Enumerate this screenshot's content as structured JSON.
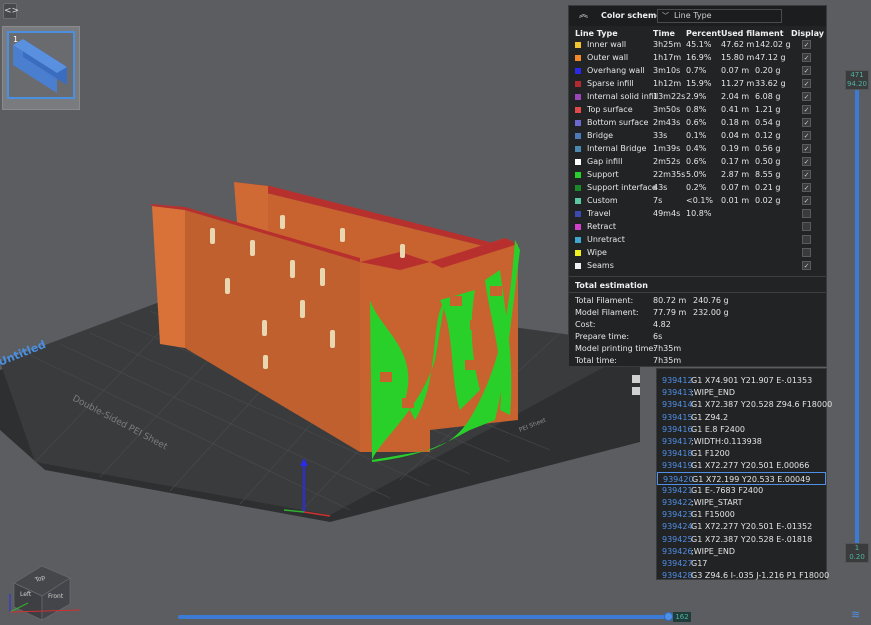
{
  "plate": {
    "number": "1"
  },
  "toolbar": {
    "collapse_glyph": "<>"
  },
  "scene": {
    "plate_brand": "Untitled",
    "sheet_label": "Double-Sided PEI Sheet",
    "sheet_label_2": "PEI Sheet"
  },
  "legend": {
    "collapse_glyph": "︽",
    "scheme_label": "Color scheme",
    "scheme_value": "Line Type",
    "headers": {
      "type": "Line Type",
      "time": "Time",
      "percent": "Percent",
      "used": "Used filament",
      "display": "Display"
    },
    "rows": [
      {
        "name": "Inner wall",
        "color": "#f2c230",
        "time": "3h25m",
        "percent": "45.1%",
        "m": "47.62 m",
        "g": "142.02 g",
        "display": true
      },
      {
        "name": "Outer wall",
        "color": "#f28a2c",
        "time": "1h17m",
        "percent": "16.9%",
        "m": "15.80 m",
        "g": "47.12 g",
        "display": true
      },
      {
        "name": "Overhang wall",
        "color": "#2a2ae8",
        "time": "3m10s",
        "percent": "0.7%",
        "m": "0.07 m",
        "g": "0.20 g",
        "display": true
      },
      {
        "name": "Sparse infill",
        "color": "#b02a30",
        "time": "1h12m",
        "percent": "15.9%",
        "m": "11.27 m",
        "g": "33.62 g",
        "display": true
      },
      {
        "name": "Internal solid infill",
        "color": "#9a46b8",
        "time": "13m22s",
        "percent": "2.9%",
        "m": "2.04 m",
        "g": "6.08 g",
        "display": true
      },
      {
        "name": "Top surface",
        "color": "#e04a4a",
        "time": "3m50s",
        "percent": "0.8%",
        "m": "0.41 m",
        "g": "1.21 g",
        "display": true
      },
      {
        "name": "Bottom surface",
        "color": "#6a6ad0",
        "time": "2m43s",
        "percent": "0.6%",
        "m": "0.18 m",
        "g": "0.54 g",
        "display": true
      },
      {
        "name": "Bridge",
        "color": "#4a7ab8",
        "time": "33s",
        "percent": "0.1%",
        "m": "0.04 m",
        "g": "0.12 g",
        "display": true
      },
      {
        "name": "Internal Bridge",
        "color": "#4a8ab0",
        "time": "1m39s",
        "percent": "0.4%",
        "m": "0.19 m",
        "g": "0.56 g",
        "display": true
      },
      {
        "name": "Gap infill",
        "color": "#ffffff",
        "time": "2m52s",
        "percent": "0.6%",
        "m": "0.17 m",
        "g": "0.50 g",
        "display": true
      },
      {
        "name": "Support",
        "color": "#2ad02a",
        "time": "22m35s",
        "percent": "5.0%",
        "m": "2.87 m",
        "g": "8.55 g",
        "display": true
      },
      {
        "name": "Support interface",
        "color": "#1a8a2a",
        "time": "43s",
        "percent": "0.2%",
        "m": "0.07 m",
        "g": "0.21 g",
        "display": true
      },
      {
        "name": "Custom",
        "color": "#5ac8a0",
        "time": "7s",
        "percent": "<0.1%",
        "m": "0.01 m",
        "g": "0.02 g",
        "display": true
      },
      {
        "name": "Travel",
        "color": "#3a4ab0",
        "time": "49m4s",
        "percent": "10.8%",
        "m": "",
        "g": "",
        "display": false
      },
      {
        "name": "Retract",
        "color": "#d040c8",
        "time": "",
        "percent": "",
        "m": "",
        "g": "",
        "display": false
      },
      {
        "name": "Unretract",
        "color": "#40a8d0",
        "time": "",
        "percent": "",
        "m": "",
        "g": "",
        "display": false
      },
      {
        "name": "Wipe",
        "color": "#f0f020",
        "time": "",
        "percent": "",
        "m": "",
        "g": "",
        "display": false
      },
      {
        "name": "Seams",
        "color": "#f0f0f0",
        "time": "",
        "percent": "",
        "m": "",
        "g": "",
        "display": true
      }
    ],
    "estimation": {
      "title": "Total estimation",
      "items": [
        {
          "label": "Total Filament:",
          "v1": "80.72 m",
          "v2": "240.76 g"
        },
        {
          "label": "Model Filament:",
          "v1": "77.79 m",
          "v2": "232.00 g"
        },
        {
          "label": "Cost:",
          "v1": "4.82",
          "v2": ""
        },
        {
          "label": "Prepare time:",
          "v1": "6s",
          "v2": ""
        },
        {
          "label": "Model printing time:",
          "v1": "7h35m",
          "v2": ""
        },
        {
          "label": "Total time:",
          "v1": "7h35m",
          "v2": ""
        }
      ]
    }
  },
  "gcode": {
    "lines": [
      {
        "n": "939412",
        "t": "G1 X74.901 Y21.907 E-.01353"
      },
      {
        "n": "939413",
        "t": ";WIPE_END"
      },
      {
        "n": "939414",
        "t": "G1 X72.387 Y20.528 Z94.6 F18000"
      },
      {
        "n": "939415",
        "t": "G1 Z94.2"
      },
      {
        "n": "939416",
        "t": "G1 E.8 F2400"
      },
      {
        "n": "939417",
        "t": ";WIDTH:0.113938"
      },
      {
        "n": "939418",
        "t": "G1 F1200"
      },
      {
        "n": "939419",
        "t": "G1 X72.277 Y20.501 E.00066"
      },
      {
        "n": "939420",
        "t": "G1 X72.199 Y20.533 E.00049"
      },
      {
        "n": "939421",
        "t": "G1 E-.7683 F2400"
      },
      {
        "n": "939422",
        "t": ";WIPE_START"
      },
      {
        "n": "939423",
        "t": "G1 F15000"
      },
      {
        "n": "939424",
        "t": "G1 X72.277 Y20.501 E-.01352"
      },
      {
        "n": "939425",
        "t": "G1 X72.387 Y20.528 E-.01818"
      },
      {
        "n": "939426",
        "t": ";WIPE_END"
      },
      {
        "n": "939427",
        "t": "G17"
      },
      {
        "n": "939428",
        "t": "G3 Z94.6 I-.035 J-1.216 P1 F18000"
      }
    ],
    "current_index": 8
  },
  "vslider": {
    "top_layer": "471",
    "top_height": "94.20",
    "bottom_layer": "1",
    "bottom_height": "0.20"
  },
  "hslider": {
    "value": "162"
  },
  "viewcube": {
    "top": "Top",
    "left": "Left",
    "front": "Front"
  }
}
